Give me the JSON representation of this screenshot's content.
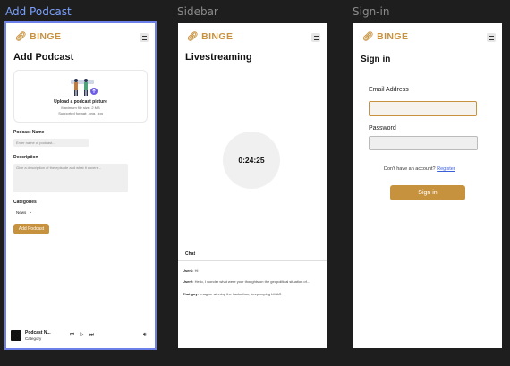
{
  "frames": {
    "add_podcast": {
      "label": "Add Podcast"
    },
    "sidebar": {
      "label": "Sidebar"
    },
    "signin": {
      "label": "Sign-in"
    }
  },
  "brand": {
    "logo_text": "BINGE",
    "accent": "#c7923e"
  },
  "add_podcast": {
    "title": "Add Podcast",
    "upload": {
      "title": "Upload a podcast picture",
      "max_size": "Maximum file size: 2 MB",
      "formats": "Supported format: .png, .jpg"
    },
    "name_label": "Podcast Name",
    "name_placeholder": "Enter name of podcast...",
    "desc_label": "Description",
    "desc_placeholder": "Give a description of the episode and what it covers...",
    "categories_label": "Categories",
    "category_value": "News",
    "submit_label": "Add Podcast"
  },
  "player": {
    "title": "Podcast N...",
    "category": "Category"
  },
  "livestream": {
    "title": "Livestreaming",
    "timer": "0:24:25",
    "chat_label": "Chat",
    "messages": [
      {
        "user": "User1:",
        "text": "Hi"
      },
      {
        "user": "User2:",
        "text": "Hello, I wonder what were your thoughts on the geopolitical situation of..."
      },
      {
        "user": "That guy:",
        "text": "Imagine winning the hackathon, keep coping LMAO"
      }
    ]
  },
  "signin": {
    "title": "Sign in",
    "email_label": "Email Address",
    "password_label": "Password",
    "no_account": "Don't have an account?",
    "register_link": "Register",
    "submit_label": "Sign in"
  }
}
